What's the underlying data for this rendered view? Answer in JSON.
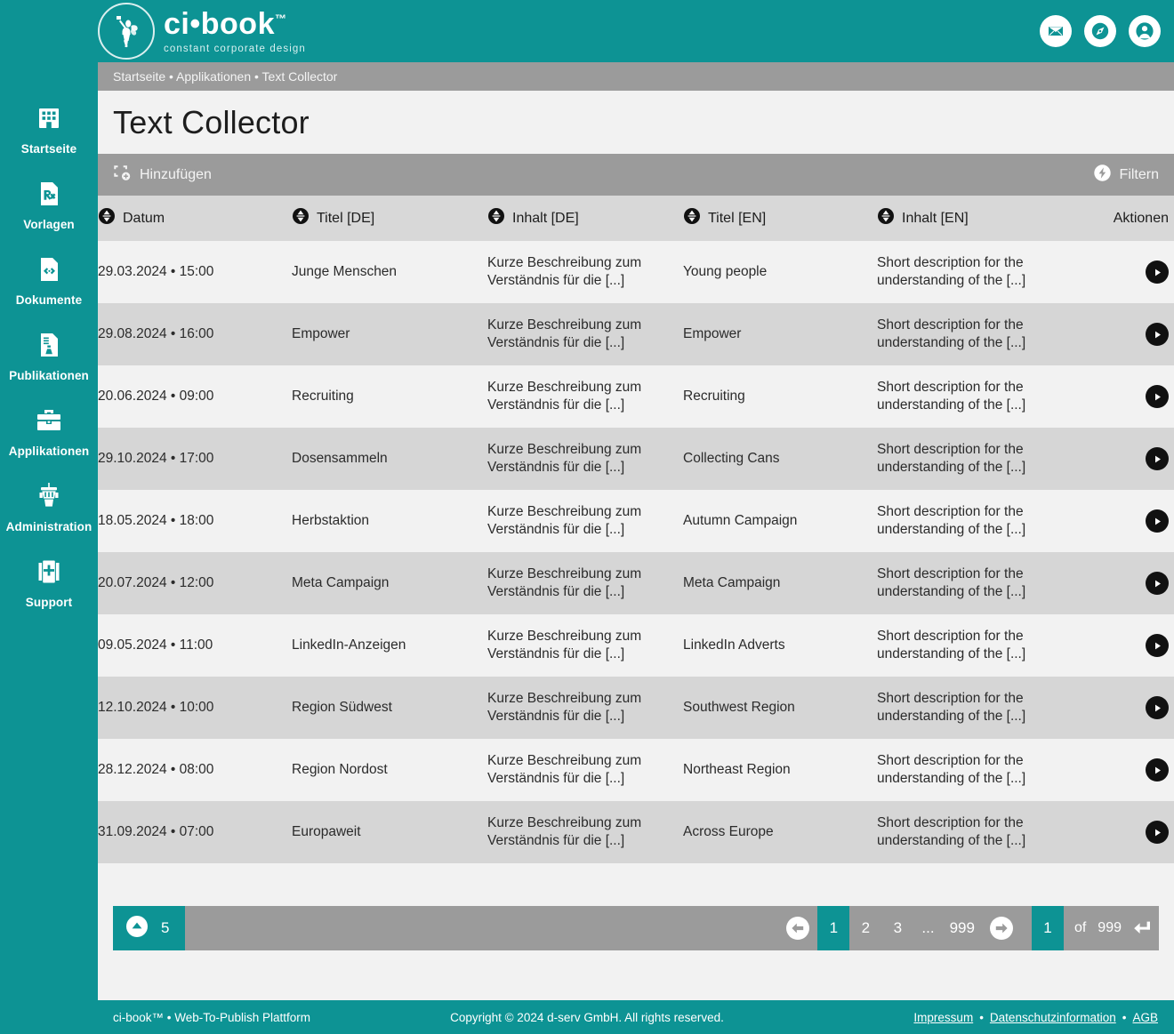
{
  "brand": {
    "name": "ci•book",
    "tm": "™",
    "tagline": "constant corporate design",
    "logo_icon": "fairy-logo-icon",
    "accent_color": "#0d9394"
  },
  "header": {
    "icons": [
      {
        "name": "mail-icon",
        "glyph": "✉"
      },
      {
        "name": "compass-icon",
        "glyph": "⦿"
      },
      {
        "name": "user-account-icon",
        "glyph": "☺"
      }
    ]
  },
  "sidebar": {
    "items": [
      {
        "label": "Startseite",
        "icon": "building-icon"
      },
      {
        "label": "Vorlagen",
        "icon": "prescription-document-icon"
      },
      {
        "label": "Dokumente",
        "icon": "code-document-icon"
      },
      {
        "label": "Publikationen",
        "icon": "publication-document-icon"
      },
      {
        "label": "Applikationen",
        "icon": "toolbox-icon"
      },
      {
        "label": "Administration",
        "icon": "control-tower-icon"
      },
      {
        "label": "Support",
        "icon": "first-aid-kit-icon"
      }
    ]
  },
  "breadcrumb": {
    "text": "Startseite • Applikationen • Text Collector",
    "parts": [
      "Startseite",
      "Applikationen",
      "Text Collector"
    ]
  },
  "page": {
    "title": "Text Collector"
  },
  "toolbar": {
    "add_label": "Hinzufügen",
    "add_icon": "add-frame-icon",
    "filter_label": "Filtern",
    "filter_icon": "lightning-filter-icon"
  },
  "table": {
    "columns": [
      {
        "label": "Datum",
        "sortable": true
      },
      {
        "label": "Titel [DE]",
        "sortable": true
      },
      {
        "label": "Inhalt [DE]",
        "sortable": true
      },
      {
        "label": "Titel [EN]",
        "sortable": true
      },
      {
        "label": "Inhalt [EN]",
        "sortable": true
      },
      {
        "label": "Aktionen",
        "sortable": false
      }
    ],
    "content_de": "Kurze Beschreibung zum Verständnis für die [...]",
    "content_en": "Short description for the understanding of the [...]",
    "action_icon": "play-action-icon",
    "rows": [
      {
        "date": "29.03.2024 • 15:00",
        "title_de": "Junge Menschen",
        "content_de": "Kurze Beschreibung zum Verständnis für die [...]",
        "title_en": "Young people",
        "content_en": "Short description for the understanding of the [...]"
      },
      {
        "date": "29.08.2024 • 16:00",
        "title_de": "Empower",
        "content_de": "Kurze Beschreibung zum Verständnis für die [...]",
        "title_en": "Empower",
        "content_en": "Short description for the understanding of the [...]"
      },
      {
        "date": "20.06.2024 • 09:00",
        "title_de": "Recruiting",
        "content_de": "Kurze Beschreibung zum Verständnis für die [...]",
        "title_en": "Recruiting",
        "content_en": "Short description for the understanding of the [...]"
      },
      {
        "date": "29.10.2024 • 17:00",
        "title_de": "Dosensammeln",
        "content_de": "Kurze Beschreibung zum Verständnis für die [...]",
        "title_en": "Collecting Cans",
        "content_en": "Short description for the understanding of the [...]"
      },
      {
        "date": "18.05.2024 • 18:00",
        "title_de": "Herbstaktion",
        "content_de": "Kurze Beschreibung zum Verständnis für die [...]",
        "title_en": "Autumn Campaign",
        "content_en": "Short description for the understanding of the [...]"
      },
      {
        "date": "20.07.2024 • 12:00",
        "title_de": "Meta Campaign",
        "content_de": "Kurze Beschreibung zum Verständnis für die [...]",
        "title_en": "Meta Campaign",
        "content_en": "Short description for the understanding of the [...]"
      },
      {
        "date": "09.05.2024 • 11:00",
        "title_de": "LinkedIn-Anzeigen",
        "content_de": "Kurze Beschreibung zum Verständnis für die [...]",
        "title_en": "LinkedIn Adverts",
        "content_en": "Short description for the understanding of the [...]"
      },
      {
        "date": "12.10.2024 • 10:00",
        "title_de": "Region Südwest",
        "content_de": "Kurze Beschreibung zum Verständnis für die [...]",
        "title_en": "Southwest Region",
        "content_en": "Short description for the understanding of the [...]"
      },
      {
        "date": "28.12.2024 • 08:00",
        "title_de": "Region Nordost",
        "content_de": "Kurze Beschreibung zum Verständnis für die [...]",
        "title_en": "Northeast Region",
        "content_en": "Short description for the understanding of the [...]"
      },
      {
        "date": "31.09.2024 • 07:00",
        "title_de": "Europaweit",
        "content_de": "Kurze Beschreibung zum Verständnis für die [...]",
        "title_en": "Across Europe",
        "content_en": "Short description for the understanding of the [...]"
      }
    ]
  },
  "pagination": {
    "page_size": "5",
    "page_size_icon": "chevron-up-icon",
    "prev_icon": "arrow-left-icon",
    "next_icon": "arrow-right-icon",
    "pages": [
      "1",
      "2",
      "3"
    ],
    "ellipsis": "...",
    "last_page": "999",
    "current_page": "1",
    "jump_value": "1",
    "of_label": "of",
    "total_pages": "999",
    "enter_icon": "enter-key-icon"
  },
  "footer": {
    "left": "ci-book™ • Web-To-Publish Plattform",
    "center": "Copyright © 2024 d-serv GmbH. All rights reserved.",
    "links": [
      "Impressum",
      "Datenschutzinformation",
      "AGB"
    ],
    "separator": "•"
  }
}
